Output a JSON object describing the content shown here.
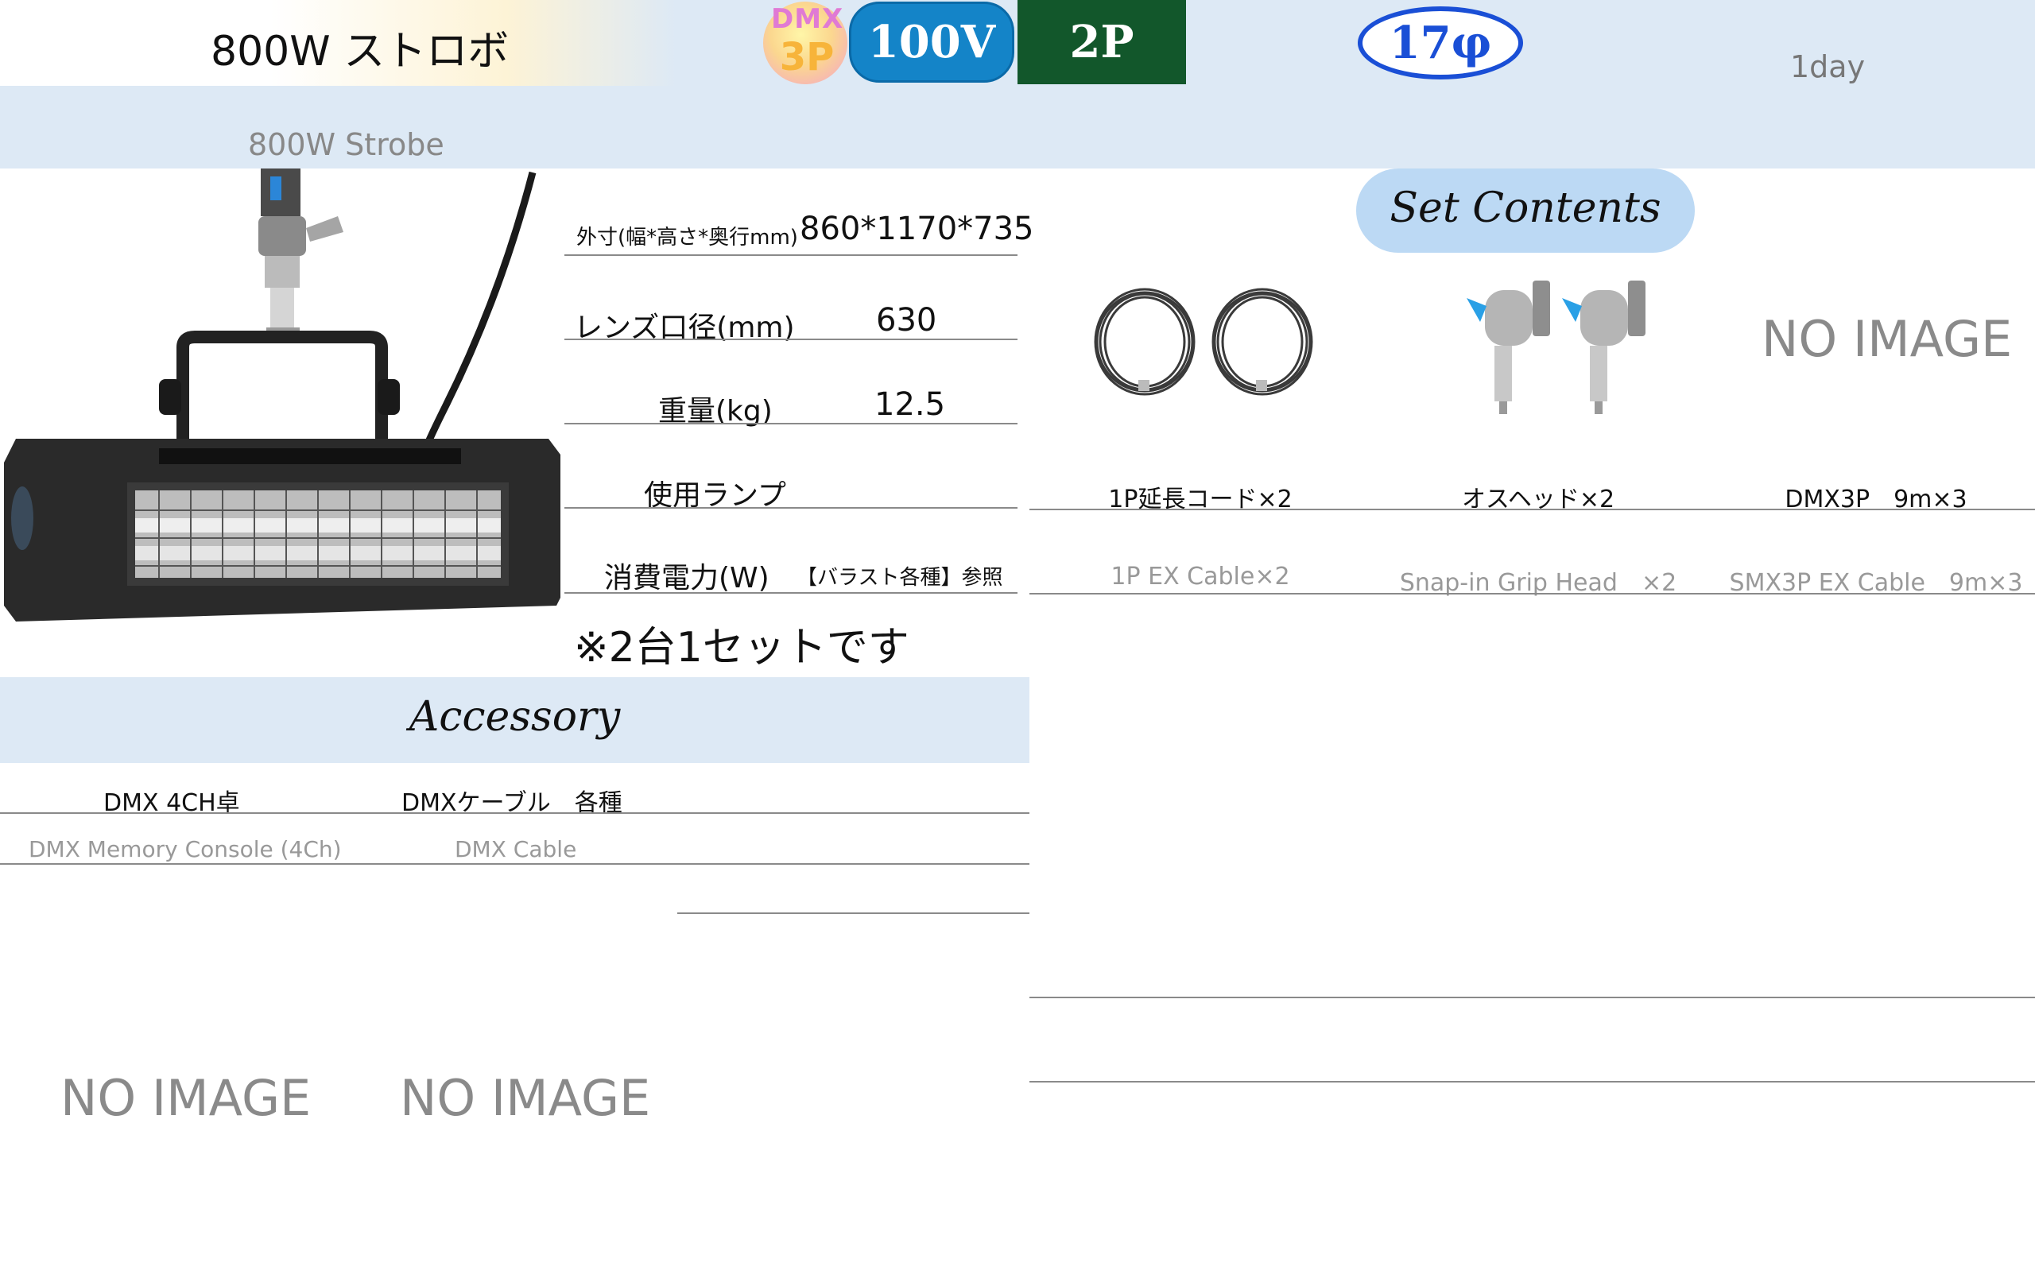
{
  "header": {
    "title": "800W ストロボ",
    "subtitle": "800W Strobe",
    "badge_dmx_top": "DMX",
    "badge_dmx_bottom": "3P",
    "badge_voltage": "100V",
    "badge_plug": "2P",
    "badge_diameter": "17φ",
    "rental_period": "1day"
  },
  "specs": {
    "dimensions_label": "外寸(幅*高さ*奥行mm)",
    "dimensions_value": "860*1170*735",
    "lens_label": "レンズ口径(mm)",
    "lens_value": "630",
    "weight_label": "重量(kg)",
    "weight_value": "12.5",
    "lamp_label": "使用ランプ",
    "power_label": "消費電力(W)",
    "power_value": "【バラスト各種】参照",
    "note": "※2台1セットです"
  },
  "set_contents": {
    "title": "Set Contents",
    "items": [
      {
        "jp": "1P延長コード×2",
        "en": "1P EX Cable×2"
      },
      {
        "jp": "オスヘッド×2",
        "en": "Snap-in Grip Head　×2"
      },
      {
        "jp": "DMX3P　9m×3",
        "en": "SMX3P EX Cable　9m×3"
      }
    ],
    "no_image_text": "NO IMAGE"
  },
  "accessory": {
    "title": "Accessory",
    "items": [
      {
        "jp": "DMX 4CH卓",
        "en": "DMX Memory Console (4Ch)"
      },
      {
        "jp": "DMXケーブル　各種",
        "en": "DMX Cable"
      }
    ],
    "no_image_text": "NO IMAGE"
  },
  "colors": {
    "band": "#dde9f5",
    "voltage_badge": "#1484c8",
    "plug_badge": "#12572b",
    "diameter_badge": "#1a4fd6"
  }
}
